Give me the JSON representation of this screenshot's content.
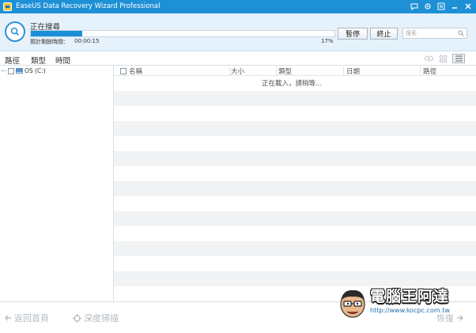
{
  "window": {
    "title": "EaseUS Data Recovery Wizard Professional"
  },
  "scan": {
    "status": "正在搜尋",
    "progress_fraction": 0.17,
    "remaining_label": "預計剩餘時間：",
    "remaining_value": "00:00:15",
    "percent_text": "17%",
    "pause_label": "暫停",
    "stop_label": "終止",
    "search_placeholder": "搜索"
  },
  "tabs": [
    {
      "label": "路徑",
      "active": true
    },
    {
      "label": "類型",
      "active": false
    },
    {
      "label": "時間",
      "active": false
    }
  ],
  "tree": {
    "items": [
      {
        "label": "OS (C:)"
      }
    ]
  },
  "list": {
    "columns": [
      "名稱",
      "大小",
      "類型",
      "日期",
      "路徑"
    ],
    "loading_text": "正在載入，請稍等..."
  },
  "bottom": {
    "home_label": "返回首頁",
    "deep_scan_label": "深度掃描",
    "recover_label": "恢復"
  },
  "watermark": {
    "title": "電腦王阿達",
    "url": "http://www.kocpc.com.tw"
  },
  "colors": {
    "accent": "#1e90d6",
    "progress": "#1c8fd8",
    "header_bg": "#e6f2fb"
  }
}
